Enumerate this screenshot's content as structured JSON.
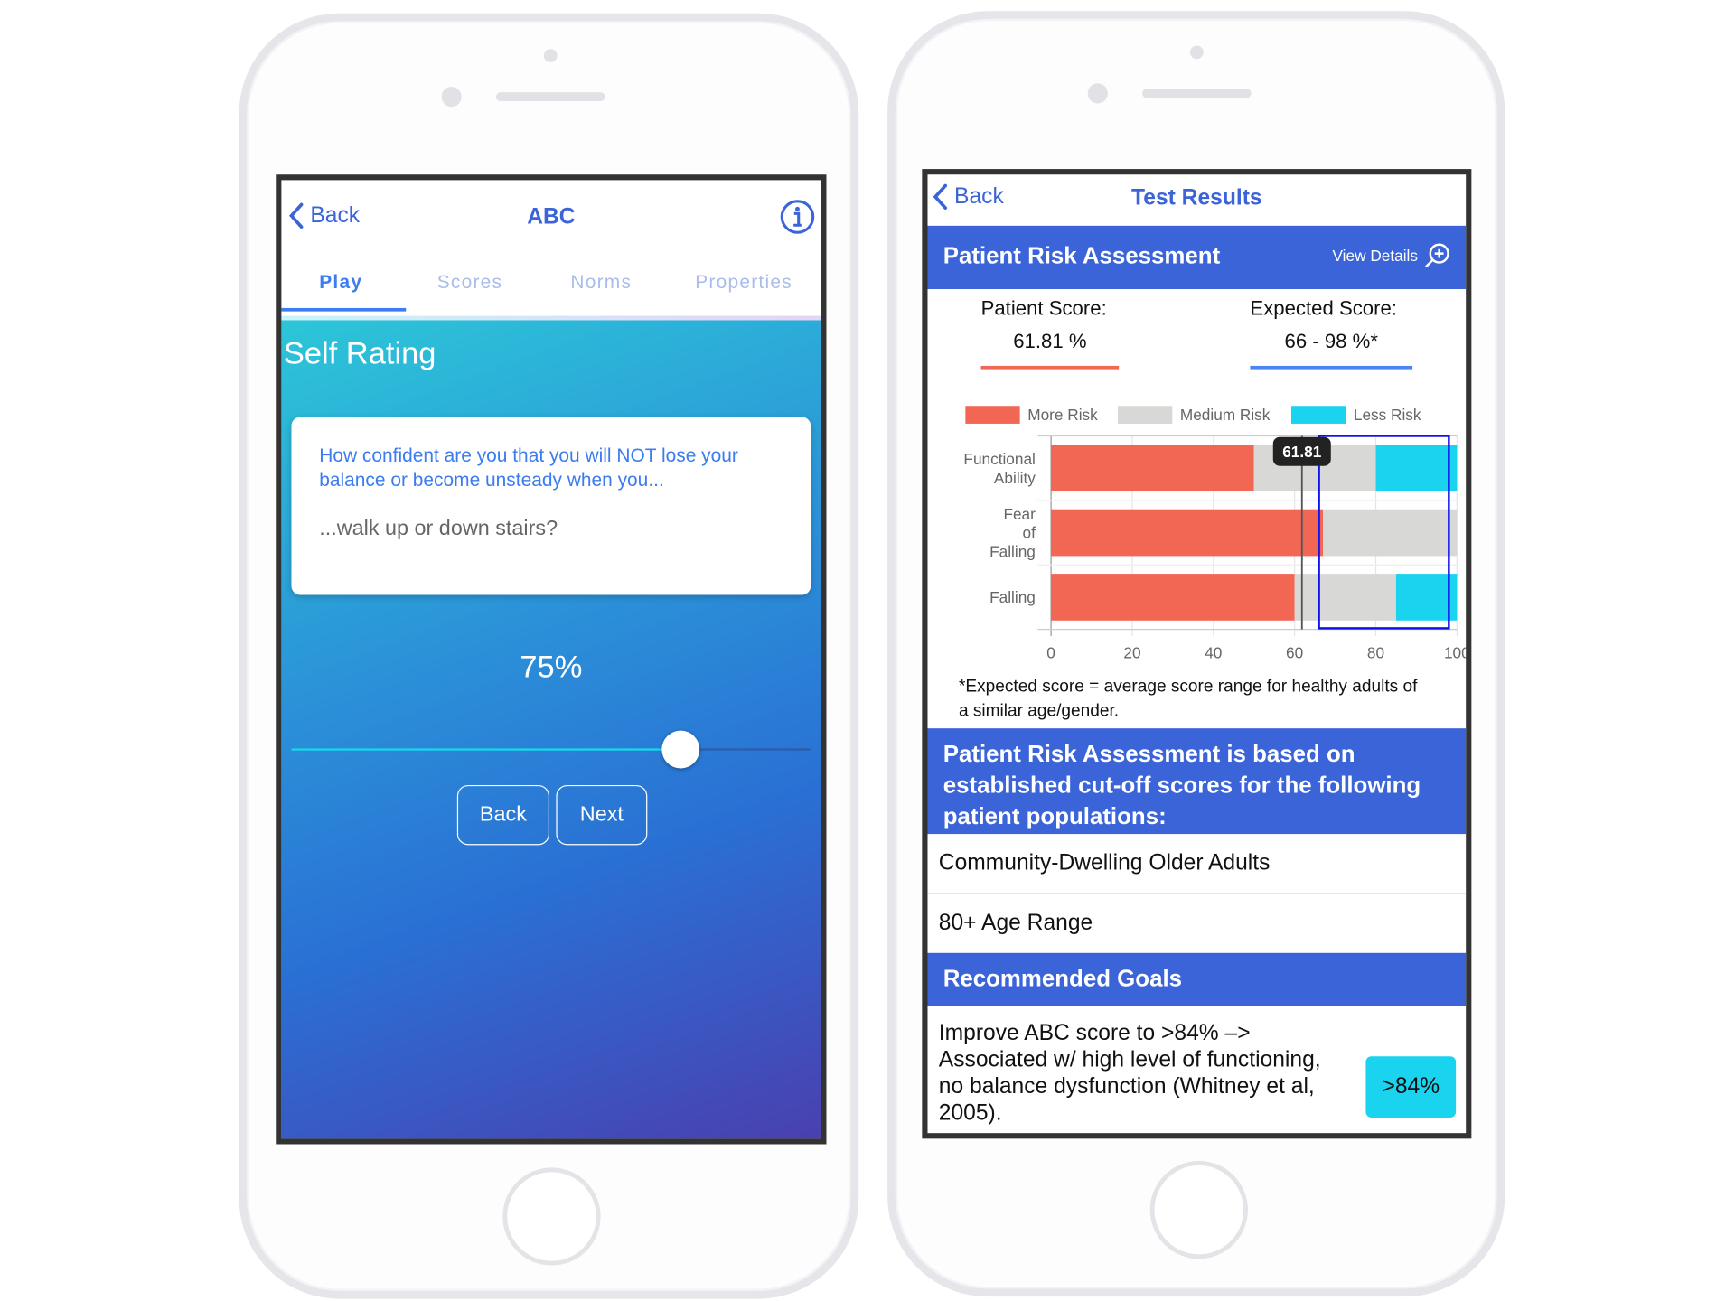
{
  "left_screen": {
    "nav": {
      "back_label": "Back",
      "title": "ABC",
      "info_icon": "info-circle-icon"
    },
    "tabs": [
      {
        "label": "Play",
        "active": true
      },
      {
        "label": "Scores",
        "active": false
      },
      {
        "label": "Norms",
        "active": false
      },
      {
        "label": "Properties",
        "active": false
      }
    ],
    "section_title": "Self Rating",
    "question": "How confident are you that you will NOT lose your balance or become unsteady when you...",
    "activity": "...walk up or down stairs?",
    "rating_label": "75%",
    "rating_value": 75,
    "buttons": {
      "back": "Back",
      "next": "Next"
    }
  },
  "right_screen": {
    "nav": {
      "back_label": "Back",
      "title": "Test Results"
    },
    "header": {
      "title": "Patient Risk Assessment",
      "view_details": "View Details",
      "icon": "zoom-in-icon"
    },
    "patient_score": {
      "label": "Patient Score:",
      "value": "61.81 %"
    },
    "expected_score": {
      "label": "Expected Score:",
      "value": "66 - 98 %*"
    },
    "footnote": "*Expected score = average score range for healthy adults of a similar age/gender.",
    "populations_header": "Patient Risk Assessment is based on established cut-off scores for the following patient populations:",
    "populations": [
      "Community-Dwelling Older Adults",
      "80+ Age Range"
    ],
    "goals_header": "Recommended Goals",
    "goal_text": "Improve ABC score to >84% –> Associated w/ high level of functioning, no balance dysfunction (Whitney et al, 2005).",
    "goal_badge": ">84%"
  },
  "colors": {
    "accent": "#3b64d8",
    "more_risk": "#f26654",
    "medium_risk": "#d8d8d6",
    "less_risk": "#1ad3ef",
    "expected_box": "#1010ee"
  },
  "chart_data": {
    "type": "bar",
    "orientation": "horizontal",
    "stacked": true,
    "categories": [
      "Functional Ability",
      "Fear of Falling",
      "Falling"
    ],
    "category_lines": [
      [
        "Functional",
        "Ability"
      ],
      [
        "Fear",
        "of",
        "Falling"
      ],
      [
        "Falling"
      ]
    ],
    "series": [
      {
        "name": "More Risk",
        "values": [
          50,
          67,
          60
        ]
      },
      {
        "name": "Medium Risk",
        "values": [
          30,
          33,
          25
        ]
      },
      {
        "name": "Less Risk",
        "values": [
          20,
          0,
          15
        ]
      }
    ],
    "xlim": [
      0,
      100
    ],
    "xticks": [
      "0",
      "20",
      "40",
      "60",
      "80",
      "100"
    ],
    "patient_score_marker": 61.81,
    "marker_label": "61.81",
    "expected_range": [
      66,
      98
    ],
    "legend_position": "top",
    "grid": true
  }
}
